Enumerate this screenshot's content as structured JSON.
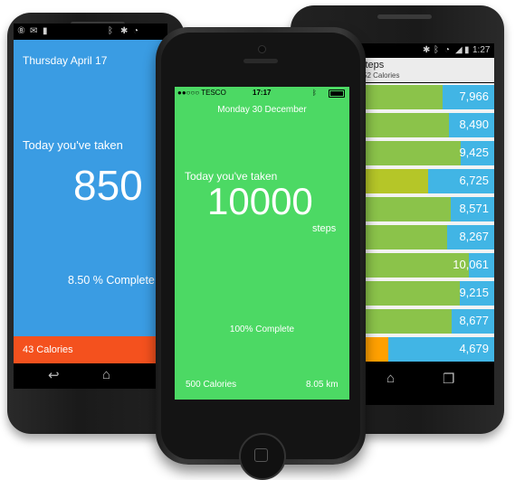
{
  "left_app": {
    "status_time": "",
    "date": "Thursday April 17",
    "taken_label": "Today you've taken",
    "steps": "850",
    "complete": "8.50 % Complete",
    "calories": "43 Calories"
  },
  "iphone_app": {
    "carrier": "●●○○○ TESCO",
    "time": "17:17",
    "date": "Monday 30 December",
    "taken_label": "Today you've taken",
    "steps": "10000",
    "unit": "steps",
    "complete": "100% Complete",
    "calories": "500 Calories",
    "distance": "8.05 km"
  },
  "right_app": {
    "status_time": "1:27",
    "title": "steps",
    "subtitle": "52 Calories",
    "rows": [
      {
        "value": "7,966",
        "fill_fraction": 0.66,
        "fill_color": "#8bc34a"
      },
      {
        "value": "8,490",
        "fill_fraction": 0.7,
        "fill_color": "#8bc34a"
      },
      {
        "value": "9,425",
        "fill_fraction": 0.78,
        "fill_color": "#8bc34a"
      },
      {
        "value": "6,725",
        "fill_fraction": 0.56,
        "fill_color": "#b5c628"
      },
      {
        "value": "8,571",
        "fill_fraction": 0.71,
        "fill_color": "#8bc34a"
      },
      {
        "value": "8,267",
        "fill_fraction": 0.69,
        "fill_color": "#8bc34a"
      },
      {
        "value": "10,061",
        "fill_fraction": 0.83,
        "fill_color": "#8bc34a"
      },
      {
        "value": "9,215",
        "fill_fraction": 0.77,
        "fill_color": "#8bc34a"
      },
      {
        "value": "8,677",
        "fill_fraction": 0.72,
        "fill_color": "#8bc34a"
      },
      {
        "value": "4,679",
        "fill_fraction": 0.3,
        "fill_color": "#ffa000"
      }
    ]
  },
  "colors": {
    "left_bg": "#3a9ce3",
    "left_calorie_bar": "#f4511e",
    "iphone_bg": "#4cd964",
    "right_row_bg": "#41b5e5"
  },
  "icons": [
    "back-arrow-icon",
    "home-icon",
    "recent-apps-icon",
    "wifi-icon",
    "battery-icon",
    "bluetooth-icon"
  ]
}
